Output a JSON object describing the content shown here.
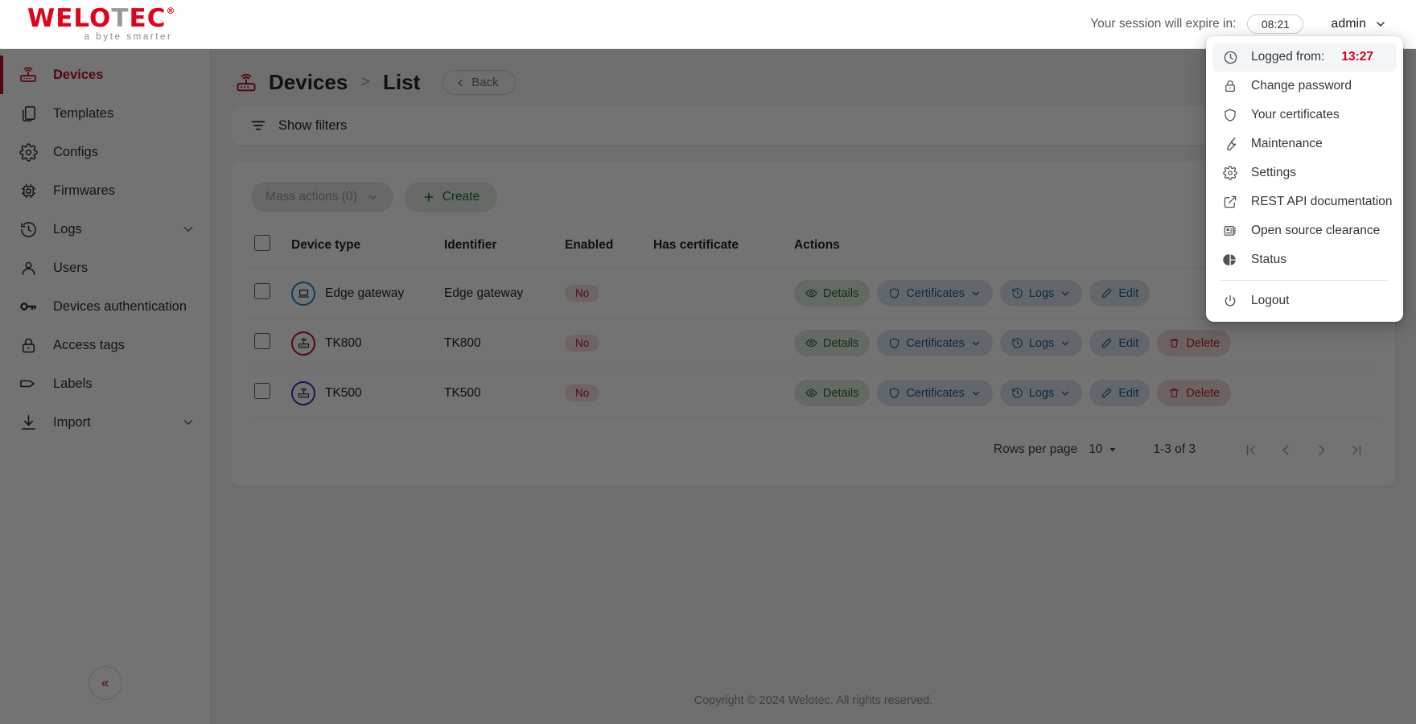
{
  "brand": {
    "name_part1": "WELO",
    "name_part2": "T",
    "name_part3": "EC",
    "trademark": "®",
    "tagline": "a byte smarter",
    "accent_color": "#e2001a"
  },
  "topbar": {
    "session_label": "Your session will expire in:",
    "session_time": "08:21",
    "user_name": "admin"
  },
  "sidebar": {
    "items": [
      {
        "label": "Devices",
        "icon": "router-icon",
        "active": true,
        "expandable": false
      },
      {
        "label": "Templates",
        "icon": "copy-icon",
        "active": false,
        "expandable": false
      },
      {
        "label": "Configs",
        "icon": "gear-icon",
        "active": false,
        "expandable": false
      },
      {
        "label": "Firmwares",
        "icon": "chip-icon",
        "active": false,
        "expandable": false
      },
      {
        "label": "Logs",
        "icon": "history-icon",
        "active": false,
        "expandable": true
      },
      {
        "label": "Users",
        "icon": "user-icon",
        "active": false,
        "expandable": false
      },
      {
        "label": "Devices authentication",
        "icon": "key-icon",
        "active": false,
        "expandable": false
      },
      {
        "label": "Access tags",
        "icon": "lock-icon",
        "active": false,
        "expandable": false
      },
      {
        "label": "Labels",
        "icon": "tag-icon",
        "active": false,
        "expandable": false
      },
      {
        "label": "Import",
        "icon": "download-icon",
        "active": false,
        "expandable": true
      }
    ],
    "collapse_label": "«"
  },
  "page": {
    "breadcrumb_root": "Devices",
    "breadcrumb_sep": ">",
    "breadcrumb_current": "List",
    "back_label": "Back",
    "filters_label": "Show filters"
  },
  "toolbar": {
    "mass_actions_label": "Mass actions (0)",
    "create_label": "Create"
  },
  "table": {
    "columns": [
      "Device type",
      "Identifier",
      "Enabled",
      "Has certificate",
      "Actions"
    ],
    "rows": [
      {
        "device_type": "Edge gateway",
        "identifier": "Edge gateway",
        "enabled": "No",
        "has_certificate": "",
        "icon": "laptop-icon",
        "icon_color": "#1b87c9",
        "actions": [
          "Details",
          "Certificates",
          "Logs",
          "Edit"
        ]
      },
      {
        "device_type": "TK800",
        "identifier": "TK800",
        "enabled": "No",
        "has_certificate": "",
        "icon": "router-icon",
        "icon_color": "#c1121f",
        "actions": [
          "Details",
          "Certificates",
          "Logs",
          "Edit",
          "Delete"
        ]
      },
      {
        "device_type": "TK500",
        "identifier": "TK500",
        "enabled": "No",
        "has_certificate": "",
        "icon": "router-icon",
        "icon_color": "#5b21b6",
        "actions": [
          "Details",
          "Certificates",
          "Logs",
          "Edit",
          "Delete"
        ]
      }
    ],
    "action_labels": {
      "details": "Details",
      "certificates": "Certificates",
      "logs": "Logs",
      "edit": "Edit",
      "delete": "Delete"
    }
  },
  "pagination": {
    "rows_per_page_label": "Rows per page",
    "rows_per_page_value": "10",
    "range_label": "1-3 of 3",
    "first_page": "|<",
    "prev_page": "<",
    "next_page": ">",
    "last_page": ">|"
  },
  "footer": {
    "copyright": "Copyright © 2024 Welotec. All rights reserved."
  },
  "user_menu": {
    "logged_from_label": "Logged from:",
    "logged_from_time": "13:27",
    "items": [
      {
        "label": "Change password",
        "icon": "lock-icon"
      },
      {
        "label": "Your certificates",
        "icon": "shield-icon"
      },
      {
        "label": "Maintenance",
        "icon": "wrench-icon"
      },
      {
        "label": "Settings",
        "icon": "gear-icon"
      },
      {
        "label": "REST API documentation",
        "icon": "external-link-icon"
      },
      {
        "label": "Open source clearance",
        "icon": "list-card-icon"
      },
      {
        "label": "Status",
        "icon": "pie-chart-icon"
      }
    ],
    "logout_label": "Logout"
  }
}
